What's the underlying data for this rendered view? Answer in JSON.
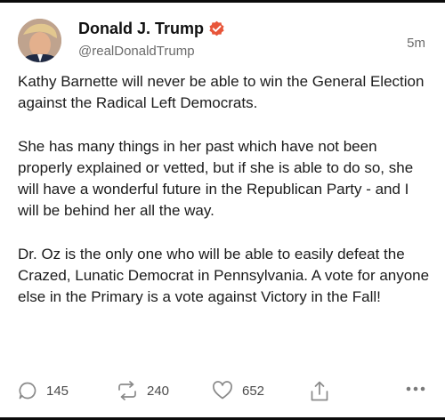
{
  "author": {
    "name": "Donald J. Trump",
    "handle": "@realDonaldTrump",
    "verified": true,
    "avatar_icon": "user-avatar-icon"
  },
  "post": {
    "timestamp": "5m",
    "paragraphs": [
      "Kathy Barnette will never be able to win the General Election against the Radical Left Democrats.",
      "She has many things in her past which have not been properly explained or vetted, but if she is able to do so, she will have a wonderful future in the Republican Party - and I will be behind her all the way.",
      "Dr. Oz is the only one who will be able to easily defeat the Crazed, Lunatic Democrat in Pennsylvania. A vote for anyone else in the Primary is a vote against Victory in the Fall!"
    ]
  },
  "actions": {
    "replies": "145",
    "retruths": "240",
    "likes": "652"
  },
  "colors": {
    "verified_badge": "#e8563a",
    "icon_gray": "#8a8a8a"
  }
}
